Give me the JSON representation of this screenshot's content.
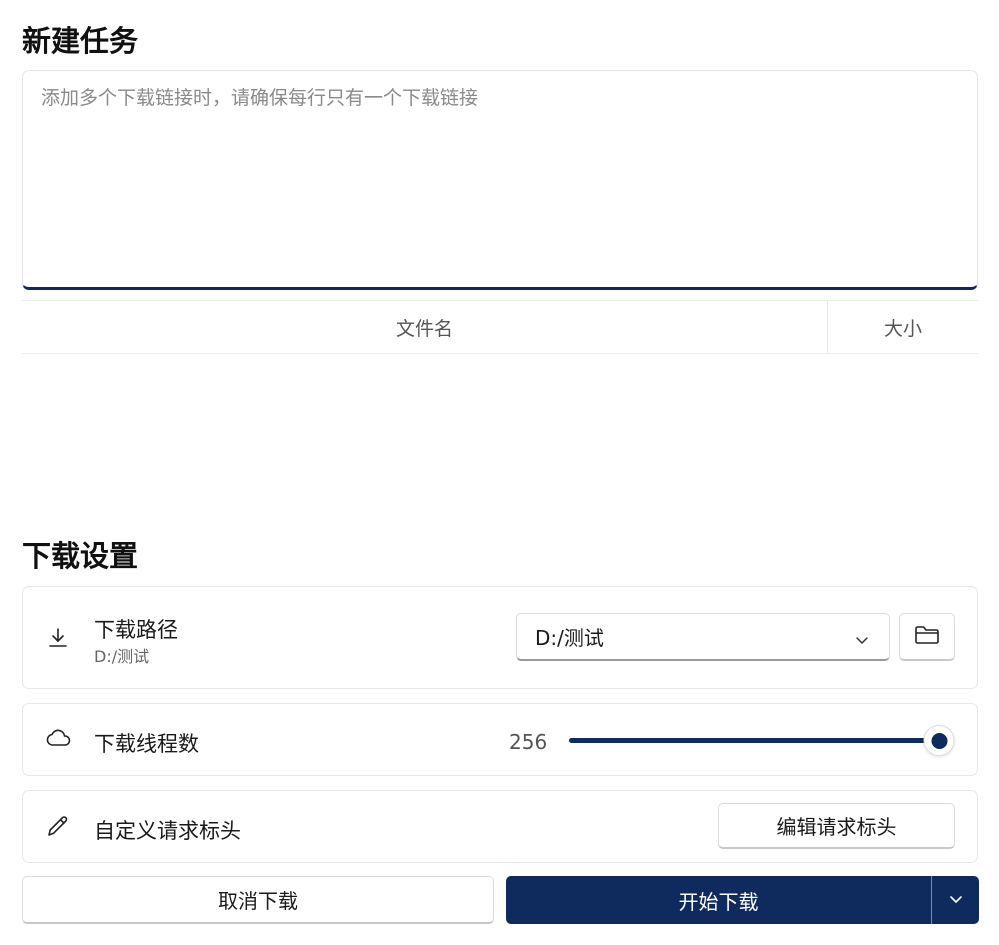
{
  "new_task": {
    "title": "新建任务",
    "url_placeholder": "添加多个下载链接时，请确保每行只有一个下载链接",
    "url_value": ""
  },
  "file_table": {
    "columns": [
      "文件名",
      "大小"
    ]
  },
  "settings": {
    "title": "下载设置",
    "path": {
      "icon": "download-icon",
      "label": "下载路径",
      "sublabel": "D:/测试",
      "selected": "D:/测试",
      "folder_icon": "folder-icon"
    },
    "threads": {
      "icon": "cloud-icon",
      "label": "下载线程数",
      "value": "256",
      "slider_fraction": 1.0
    },
    "headers": {
      "icon": "pencil-icon",
      "label": "自定义请求标头",
      "button": "编辑请求标头"
    }
  },
  "actions": {
    "cancel": "取消下载",
    "start": "开始下载"
  },
  "colors": {
    "accent": "#0f2a5c"
  }
}
